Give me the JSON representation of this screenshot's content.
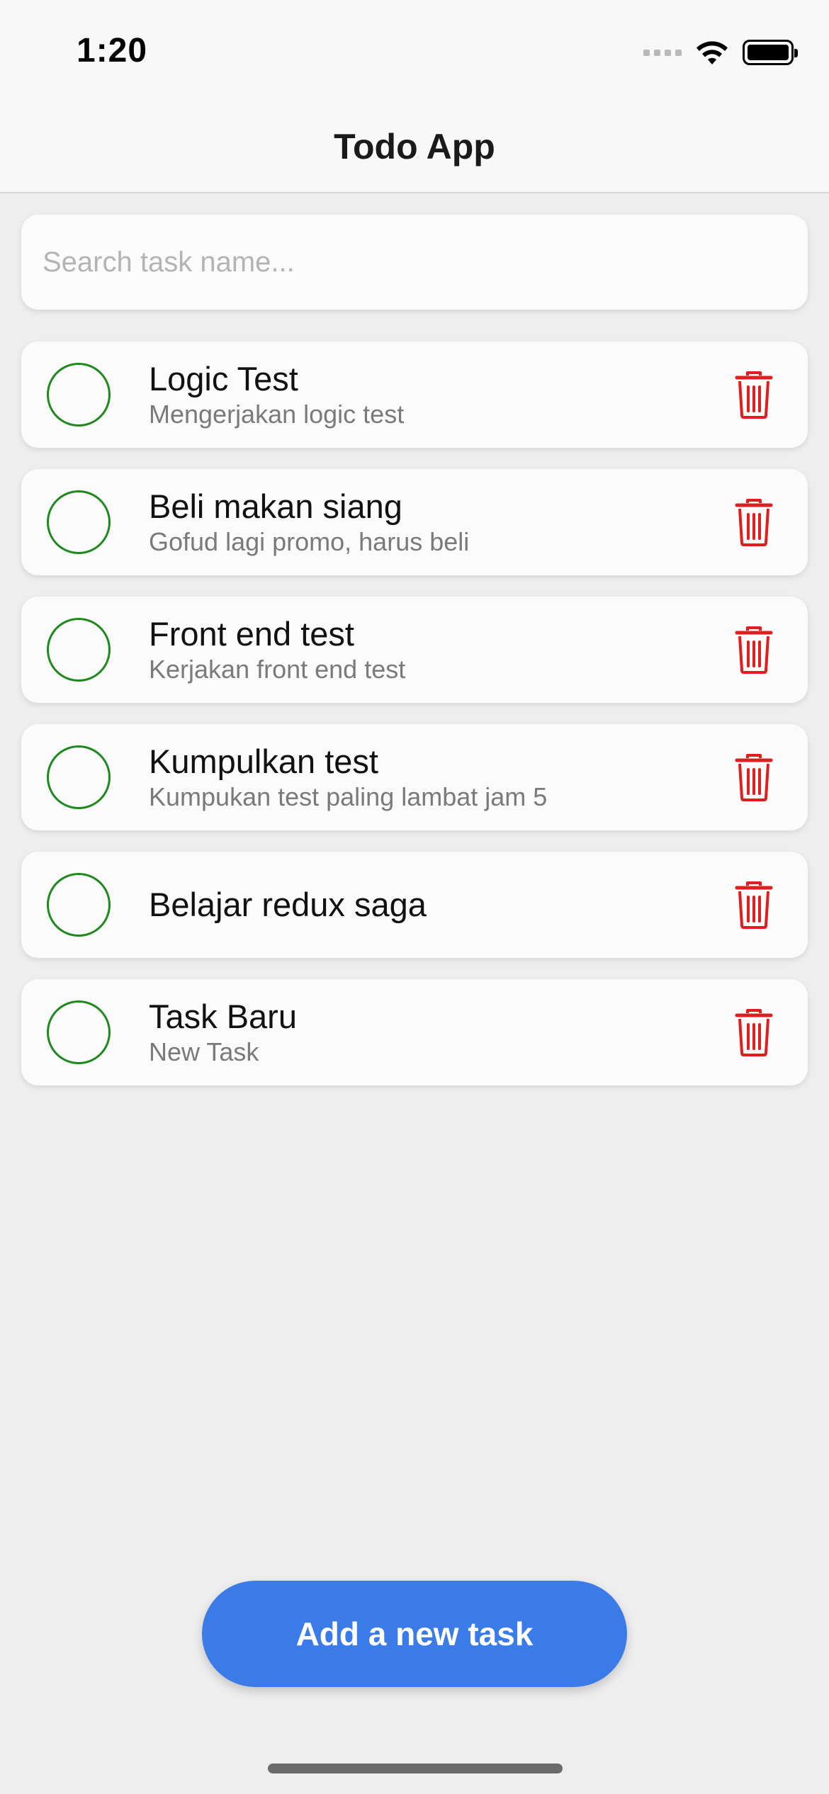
{
  "status_bar": {
    "time": "1:20"
  },
  "header": {
    "title": "Todo App"
  },
  "search": {
    "placeholder": "Search task name...",
    "value": ""
  },
  "tasks": [
    {
      "title": "Logic Test",
      "description": "Mengerjakan logic test"
    },
    {
      "title": "Beli makan siang",
      "description": "Gofud lagi promo, harus beli"
    },
    {
      "title": "Front end test",
      "description": "Kerjakan front end test"
    },
    {
      "title": "Kumpulkan test",
      "description": "Kumpukan test paling lambat jam 5"
    },
    {
      "title": "Belajar redux saga",
      "description": ""
    },
    {
      "title": "Task Baru",
      "description": "New Task"
    }
  ],
  "icons": {
    "check": "circle-outline-icon",
    "delete": "trash-icon"
  },
  "colors": {
    "accent": "#3b7be8",
    "check": "#1e8a1e",
    "delete": "#e11d1d"
  },
  "add_button": {
    "label": "Add a new task"
  }
}
